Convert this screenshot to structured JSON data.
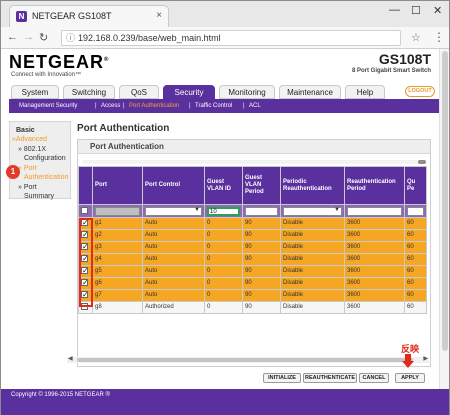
{
  "browser": {
    "tab_title": "NETGEAR GS108T",
    "tab_close": "×",
    "favicon": "N",
    "url": "192.168.0.239/base/web_main.html",
    "window_controls": [
      "—",
      "☐",
      "✕"
    ]
  },
  "header": {
    "logo": "NETGEAR",
    "logo_reg": "®",
    "tagline": "Connect with Innovation™",
    "model": "GS108T",
    "model_sub": "8 Port Gigabit Smart Switch"
  },
  "main_nav": {
    "tabs": [
      "System",
      "Switching",
      "QoS",
      "Security",
      "Monitoring",
      "Maintenance",
      "Help"
    ],
    "active": "Security",
    "logout": "LOGOUT"
  },
  "sub_nav": {
    "items": [
      "Management Security",
      "|",
      "Access",
      "|",
      "Port Authentication",
      "|",
      "Traffic Control",
      "|",
      "ACL"
    ],
    "current": "Port Authentication"
  },
  "sidebar": {
    "basic": "Basic",
    "advanced": "Advanced",
    "items": [
      "» 802.1X",
      "Configuration",
      "» Port",
      "Authentication",
      "» Port",
      "Summary"
    ],
    "marker": "1"
  },
  "page": {
    "title": "Port Authentication",
    "panel_title": "Port Authentication"
  },
  "table": {
    "headers": [
      "",
      "Port",
      "Port Control",
      "Guest VLAN ID",
      "Guest VLAN Period",
      "Periodic Reauthentication",
      "Reauthentication Period",
      "Qu Pe"
    ],
    "filter": {
      "port_control": "",
      "guest_vlan_id": "10",
      "periodic": ""
    },
    "rows": [
      {
        "checked": true,
        "port": "g1",
        "control": "Auto",
        "vlan": "0",
        "period": "90",
        "periodic": "Disable",
        "reauth": "3600",
        "qp": "60"
      },
      {
        "checked": true,
        "port": "g2",
        "control": "Auto",
        "vlan": "0",
        "period": "90",
        "periodic": "Disable",
        "reauth": "3600",
        "qp": "60"
      },
      {
        "checked": true,
        "port": "g3",
        "control": "Auto",
        "vlan": "0",
        "period": "90",
        "periodic": "Disable",
        "reauth": "3600",
        "qp": "60"
      },
      {
        "checked": true,
        "port": "g4",
        "control": "Auto",
        "vlan": "0",
        "period": "90",
        "periodic": "Disable",
        "reauth": "3600",
        "qp": "60"
      },
      {
        "checked": true,
        "port": "g5",
        "control": "Auto",
        "vlan": "0",
        "period": "90",
        "periodic": "Disable",
        "reauth": "3600",
        "qp": "60"
      },
      {
        "checked": true,
        "port": "g6",
        "control": "Auto",
        "vlan": "0",
        "period": "90",
        "periodic": "Disable",
        "reauth": "3600",
        "qp": "60"
      },
      {
        "checked": true,
        "port": "g7",
        "control": "Auto",
        "vlan": "0",
        "period": "90",
        "periodic": "Disable",
        "reauth": "3600",
        "qp": "60"
      },
      {
        "checked": false,
        "port": "g8",
        "control": "Authorized",
        "vlan": "0",
        "period": "90",
        "periodic": "Disable",
        "reauth": "3600",
        "qp": "60"
      }
    ]
  },
  "buttons": {
    "initialize": "INITIALIZE",
    "reauthenticate": "REAUTHENTICATE",
    "cancel": "CANCEL",
    "apply": "APPLY"
  },
  "annotation": {
    "apply_note": "反映"
  },
  "footer": {
    "copyright": "Copyright © 1996-2015 NETGEAR ®"
  },
  "colors": {
    "brand_purple": "#5a2f9e",
    "selected_row": "#f5a623",
    "annotation_red": "#e02a1a"
  }
}
